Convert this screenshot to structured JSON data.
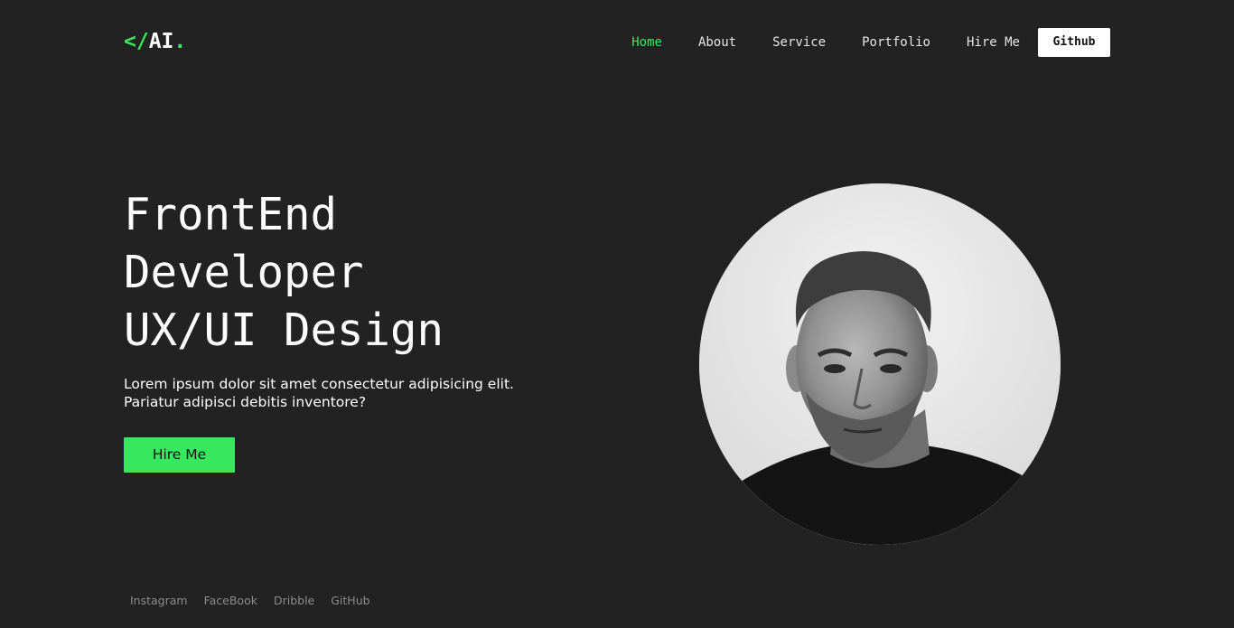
{
  "logo": {
    "prefix": "</",
    "name": "AI",
    "suffix": "."
  },
  "nav": {
    "items": [
      {
        "label": "Home",
        "active": true
      },
      {
        "label": "About",
        "active": false
      },
      {
        "label": "Service",
        "active": false
      },
      {
        "label": "Portfolio",
        "active": false
      },
      {
        "label": "Hire Me",
        "active": false
      }
    ],
    "github_label": "Github"
  },
  "hero": {
    "title_lines": [
      "FrontEnd",
      "Developer",
      "UX/UI Design"
    ],
    "description_lines": [
      "Lorem ipsum dolor sit amet consectetur adipisicing elit.",
      "Pariatur adipisci debitis inventore?"
    ],
    "cta_label": "Hire Me"
  },
  "social": {
    "links": [
      "Instagram",
      "FaceBook",
      "Dribble",
      "GitHub"
    ]
  },
  "colors": {
    "background": "#222222",
    "accent": "#39e75f",
    "text": "#ffffff",
    "muted": "#8c8c8c"
  },
  "icons": {
    "portrait": "portrait-photo"
  }
}
